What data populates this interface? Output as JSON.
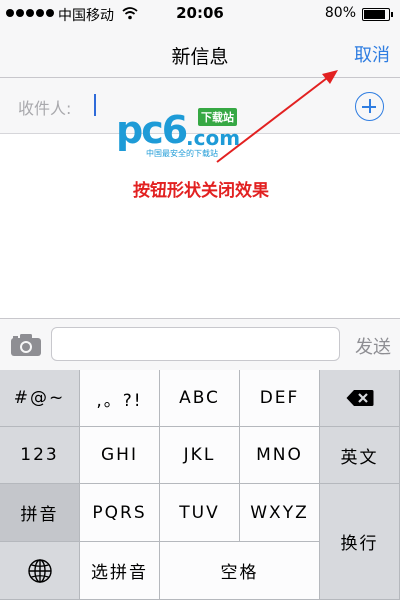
{
  "status_bar": {
    "carrier": "中国移动",
    "time": "20:06",
    "battery": "80%",
    "icons": [
      "signal-dots-icon",
      "wifi-icon",
      "battery-icon"
    ]
  },
  "nav": {
    "title": "新信息",
    "cancel_label": "取消"
  },
  "recipient": {
    "label": "收件人:",
    "value": "",
    "add_icon": "plus-circle-icon"
  },
  "watermark": {
    "brand": "pc6",
    "domain": ".com",
    "badge": "下载站",
    "slogan": "中国最安全的下载站"
  },
  "annotation": {
    "text": "按钮形状关闭效果",
    "color": "#e22121"
  },
  "compose": {
    "camera_icon": "camera-icon",
    "message_value": "",
    "send_label": "发送"
  },
  "keyboard": {
    "row1": [
      "#@~",
      ",。?!",
      "ABC",
      "DEF"
    ],
    "delete_icon": "delete-backspace-icon",
    "row2": [
      "123",
      "GHI",
      "JKL",
      "MNO",
      "英文"
    ],
    "row3": [
      "拼音",
      "PQRS",
      "TUV",
      "WXYZ"
    ],
    "newline": "换行",
    "row4_globe_icon": "globe-icon",
    "select_pinyin": "选拼音",
    "space": "空格"
  },
  "colors": {
    "accent": "#2f7de1",
    "annotation": "#e22121",
    "watermark": "#1e9bd7"
  }
}
